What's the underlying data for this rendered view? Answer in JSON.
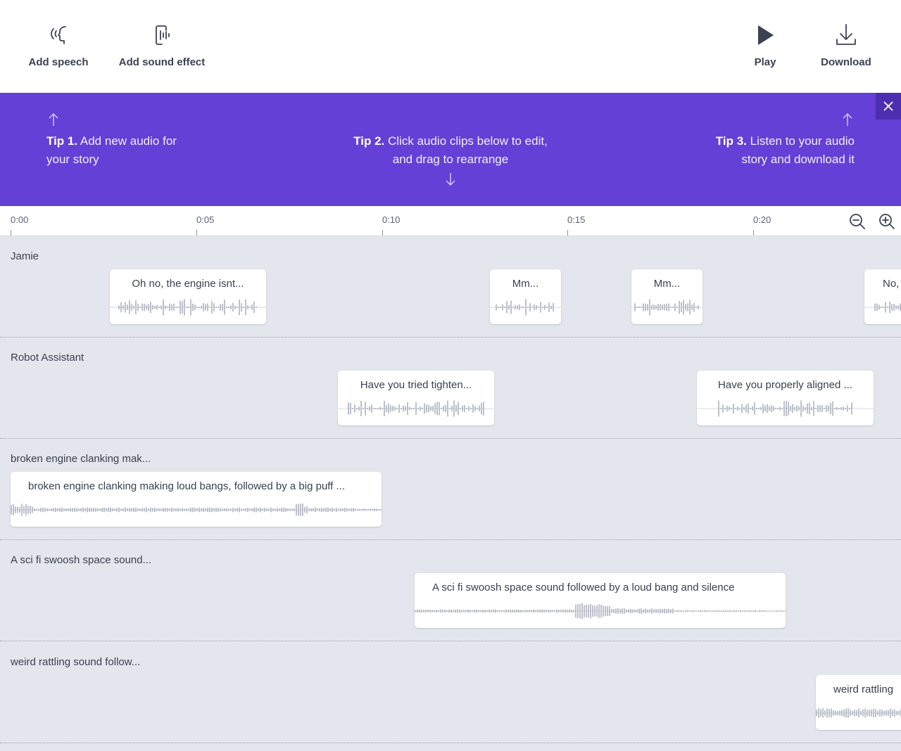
{
  "toolbar": {
    "add_speech": "Add speech",
    "add_sound_effect": "Add sound effect",
    "play": "Play",
    "download": "Download"
  },
  "tips": {
    "tip1_title": "Tip 1.",
    "tip1_text": "Add new audio for your story",
    "tip2_title": "Tip 2.",
    "tip2_text": "Click audio clips below to edit, and drag to rearrange",
    "tip3_title": "Tip 3.",
    "tip3_text": "Listen to your audio story and download it"
  },
  "timeline": {
    "ticks": [
      "0:00",
      "0:05",
      "0:10",
      "0:15",
      "0:20"
    ]
  },
  "tracks": [
    {
      "name": "Jamie",
      "clips": [
        {
          "text": "Oh no, the engine isnt..."
        },
        {
          "text": "Mm..."
        },
        {
          "text": "Mm..."
        },
        {
          "text": "No,"
        }
      ]
    },
    {
      "name": "Robot Assistant",
      "clips": [
        {
          "text": "Have you tried tighten..."
        },
        {
          "text": "Have you properly aligned ..."
        }
      ]
    },
    {
      "name": "broken engine clanking mak...",
      "clips": [
        {
          "text": "broken engine clanking making loud bangs, followed by a big puff ..."
        }
      ]
    },
    {
      "name": "A sci fi swoosh space sound...",
      "clips": [
        {
          "text": "A sci fi swoosh space sound followed by a loud bang and silence"
        }
      ]
    },
    {
      "name": "weird rattling sound follow...",
      "clips": [
        {
          "text": "weird rattling"
        }
      ]
    }
  ],
  "colors": {
    "accent": "#6440d6",
    "background": "#e3e6ec",
    "waveform": "#a4a9b6"
  }
}
